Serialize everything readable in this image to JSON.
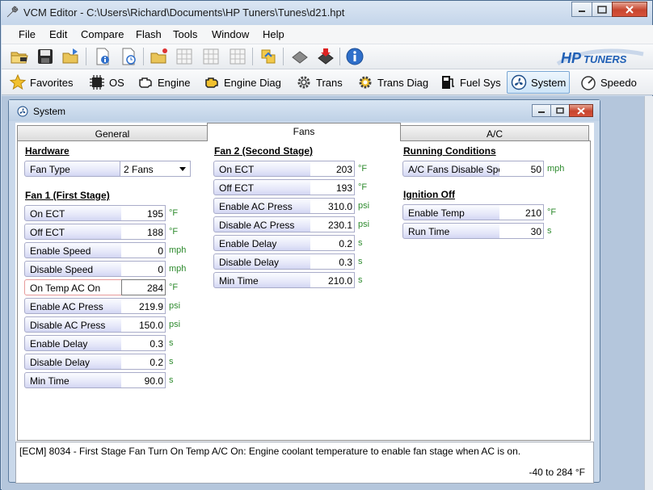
{
  "window": {
    "title": "VCM Editor - C:\\Users\\Richard\\Documents\\HP Tuners\\Tunes\\d21.hpt"
  },
  "menu": [
    "File",
    "Edit",
    "Compare",
    "Flash",
    "Tools",
    "Window",
    "Help"
  ],
  "brand": {
    "logo_text": "HP TUNERS",
    "accent": "#1f5fb5"
  },
  "nav": [
    {
      "label": "Favorites",
      "icon": "star-icon"
    },
    {
      "label": "OS",
      "icon": "chip-icon"
    },
    {
      "label": "Engine",
      "icon": "engine-icon"
    },
    {
      "label": "Engine Diag",
      "icon": "engine-diag-icon"
    },
    {
      "label": "Trans",
      "icon": "gear-icon"
    },
    {
      "label": "Trans Diag",
      "icon": "trans-diag-icon"
    },
    {
      "label": "Fuel Sys",
      "icon": "fuel-pump-icon"
    },
    {
      "label": "System",
      "icon": "fan-icon",
      "active": true
    },
    {
      "label": "Speedo",
      "icon": "speedometer-icon"
    }
  ],
  "child": {
    "title": "System"
  },
  "tabs": [
    "General",
    "Fans",
    "A/C"
  ],
  "active_tab": "Fans",
  "hardware": {
    "heading": "Hardware",
    "fan_type_label": "Fan Type",
    "fan_type_value": "2 Fans"
  },
  "fan1": {
    "heading": "Fan 1 (First Stage)",
    "rows": [
      {
        "label": "On ECT",
        "value": "195",
        "unit": "°F"
      },
      {
        "label": "Off ECT",
        "value": "188",
        "unit": "°F"
      },
      {
        "label": "Enable Speed",
        "value": "0",
        "unit": "mph"
      },
      {
        "label": "Disable Speed",
        "value": "0",
        "unit": "mph"
      },
      {
        "label": "On Temp AC On",
        "value": "284",
        "unit": "°F"
      },
      {
        "label": "Enable AC Press",
        "value": "219.9",
        "unit": "psi"
      },
      {
        "label": "Disable AC Press",
        "value": "150.0",
        "unit": "psi"
      },
      {
        "label": "Enable Delay",
        "value": "0.3",
        "unit": "s"
      },
      {
        "label": "Disable Delay",
        "value": "0.2",
        "unit": "s"
      },
      {
        "label": "Min Time",
        "value": "90.0",
        "unit": "s"
      }
    ]
  },
  "fan2": {
    "heading": "Fan 2 (Second Stage)",
    "rows": [
      {
        "label": "On ECT",
        "value": "203",
        "unit": "°F"
      },
      {
        "label": "Off ECT",
        "value": "193",
        "unit": "°F"
      },
      {
        "label": "Enable AC Press",
        "value": "310.0",
        "unit": "psi"
      },
      {
        "label": "Disable AC Press",
        "value": "230.1",
        "unit": "psi"
      },
      {
        "label": "Enable Delay",
        "value": "0.2",
        "unit": "s"
      },
      {
        "label": "Disable Delay",
        "value": "0.3",
        "unit": "s"
      },
      {
        "label": "Min Time",
        "value": "210.0",
        "unit": "s"
      }
    ]
  },
  "running": {
    "heading": "Running Conditions",
    "rows": [
      {
        "label": "A/C Fans Disable Speed",
        "value": "50",
        "unit": "mph"
      }
    ]
  },
  "ignition": {
    "heading": "Ignition Off",
    "rows": [
      {
        "label": "Enable Temp",
        "value": "210",
        "unit": "°F"
      },
      {
        "label": "Run Time",
        "value": "30",
        "unit": "s"
      }
    ]
  },
  "info": {
    "description": "[ECM] 8034 - First Stage Fan Turn On Temp A/C On: Engine coolant temperature to enable fan stage when AC is on.",
    "range": "-40 to 284 °F"
  }
}
